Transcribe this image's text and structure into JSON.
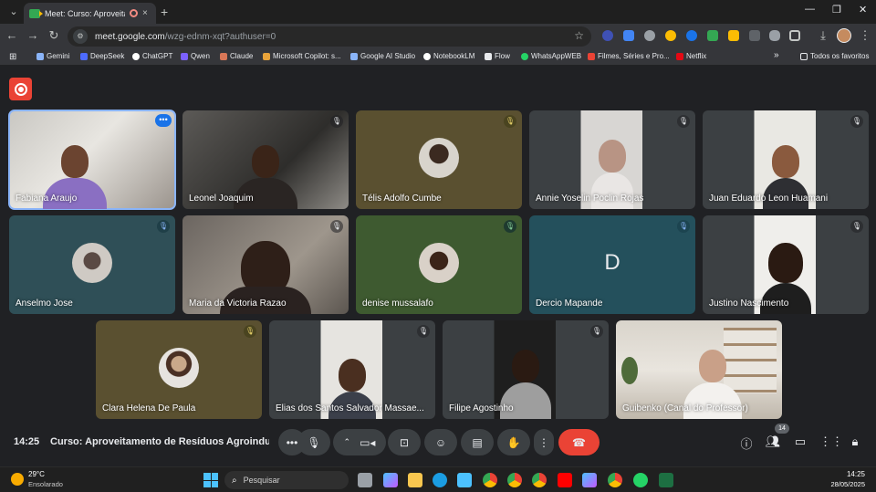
{
  "browser": {
    "tab_title": "Meet: Curso: Aproveitamen",
    "tab_close": "×",
    "new_tab": "+",
    "url_host": "meet.google.com",
    "url_path": "/wzg-ednm-xqt?authuser=0",
    "window_controls": [
      "—",
      "❐",
      "✕"
    ],
    "nav": {
      "back": "←",
      "forward": "→",
      "reload": "↻"
    }
  },
  "bookmarks": {
    "items": [
      {
        "label": "Gemini",
        "color": "#8ab4f8"
      },
      {
        "label": "DeepSeek",
        "color": "#4d6bfe"
      },
      {
        "label": "ChatGPT",
        "color": "#ffffff"
      },
      {
        "label": "Qwen",
        "color": "#7b61ff"
      },
      {
        "label": "Claude",
        "color": "#d97757"
      },
      {
        "label": "Microsoft Copilot: s...",
        "color": "#e8a33a"
      },
      {
        "label": "Google AI Studio",
        "color": "#8ab4f8"
      },
      {
        "label": "NotebookLM",
        "color": "#ffffff"
      },
      {
        "label": "Flow",
        "color": "#e8eaed"
      },
      {
        "label": "WhatsAppWEB",
        "color": "#25d366"
      },
      {
        "label": "Filmes, Séries e Pro...",
        "color": "#ea4335"
      },
      {
        "label": "Netflix",
        "color": "#e50914"
      }
    ],
    "overflow": "»",
    "all_bookmarks": "Todos os favoritos"
  },
  "meeting": {
    "time": "14:25",
    "title": "Curso: Aproveitamento de Resíduos Agroindustri...",
    "participant_count": "14",
    "participants": [
      {
        "name": "Fabiana Araujo",
        "type": "video",
        "muted": false
      },
      {
        "name": "Leonel Joaquim",
        "type": "video",
        "muted": true
      },
      {
        "name": "Télis Adolfo Cumbe",
        "type": "avatar",
        "muted": true
      },
      {
        "name": "Annie Yoselin Poclin Rojas",
        "type": "video",
        "muted": true
      },
      {
        "name": "Juan Eduardo Leon Huamani",
        "type": "video",
        "muted": true
      },
      {
        "name": "Anselmo Jose",
        "type": "avatar",
        "muted": true
      },
      {
        "name": "Maria da Victoria Razao",
        "type": "video",
        "muted": true
      },
      {
        "name": "denise mussalafo",
        "type": "avatar",
        "muted": true
      },
      {
        "name": "Dercio Mapande",
        "type": "letter",
        "letter": "D",
        "muted": true
      },
      {
        "name": "Justino Nascimento",
        "type": "video",
        "muted": true
      },
      {
        "name": "Clara Helena De Paula",
        "type": "avatar",
        "muted": true
      },
      {
        "name": "Elias dos Santos Salvador Massae...",
        "type": "video",
        "muted": true
      },
      {
        "name": "Filipe Agostinho",
        "type": "video",
        "muted": true
      },
      {
        "name": "Guibenko (Canal do Professor)",
        "type": "video",
        "muted": false
      }
    ]
  },
  "taskbar": {
    "temperature": "29°C",
    "weather": "Ensolarado",
    "search_placeholder": "Pesquisar",
    "time": "14:25",
    "date": "28/05/2025"
  }
}
